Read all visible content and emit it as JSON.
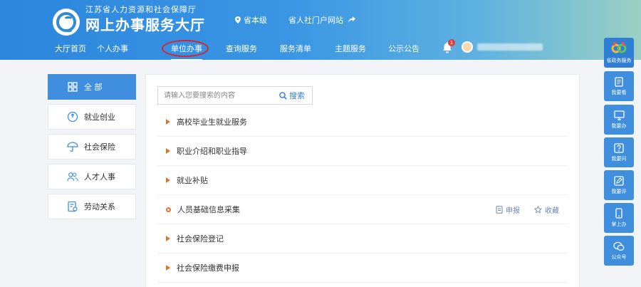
{
  "header": {
    "org_name": "江苏省人力资源和社会保障厅",
    "title": "网上办事服务大厅",
    "region": "省本级",
    "portal_link": "省人社门户网站",
    "notification_count": "1"
  },
  "nav": {
    "items": [
      {
        "label": "大厅首页"
      },
      {
        "label": "个人办事"
      },
      {
        "label": "单位办事"
      },
      {
        "label": "查询服务"
      },
      {
        "label": "服务清单"
      },
      {
        "label": "主题服务"
      },
      {
        "label": "公示公告"
      }
    ],
    "active_index": 2
  },
  "sidebar": {
    "items": [
      {
        "label": "全 部",
        "icon": "grid-icon"
      },
      {
        "label": "就业创业",
        "icon": "employment-icon"
      },
      {
        "label": "社会保险",
        "icon": "umbrella-icon"
      },
      {
        "label": "人才人事",
        "icon": "people-icon"
      },
      {
        "label": "劳动关系",
        "icon": "document-icon"
      }
    ]
  },
  "search": {
    "placeholder": "请输入您要搜索的内容",
    "button_label": "搜索"
  },
  "services": {
    "items": [
      {
        "label": "高校毕业生就业服务"
      },
      {
        "label": "职业介绍和职业指导"
      },
      {
        "label": "就业补贴"
      },
      {
        "label": "人员基础信息采集"
      },
      {
        "label": "社会保险登记"
      },
      {
        "label": "社会保险缴费申报"
      }
    ],
    "apply_label": "申报",
    "favorite_label": "收藏"
  },
  "float_bar": {
    "items": [
      {
        "label": "省政务服务"
      },
      {
        "label": "我要看"
      },
      {
        "label": "我要办"
      },
      {
        "label": "我要问"
      },
      {
        "label": "我要评"
      },
      {
        "label": "掌上办"
      },
      {
        "label": "公众号"
      }
    ]
  },
  "colors": {
    "accent": "#3f8fde",
    "highlight_circle": "#d9232e",
    "bullet": "#e0742a"
  }
}
